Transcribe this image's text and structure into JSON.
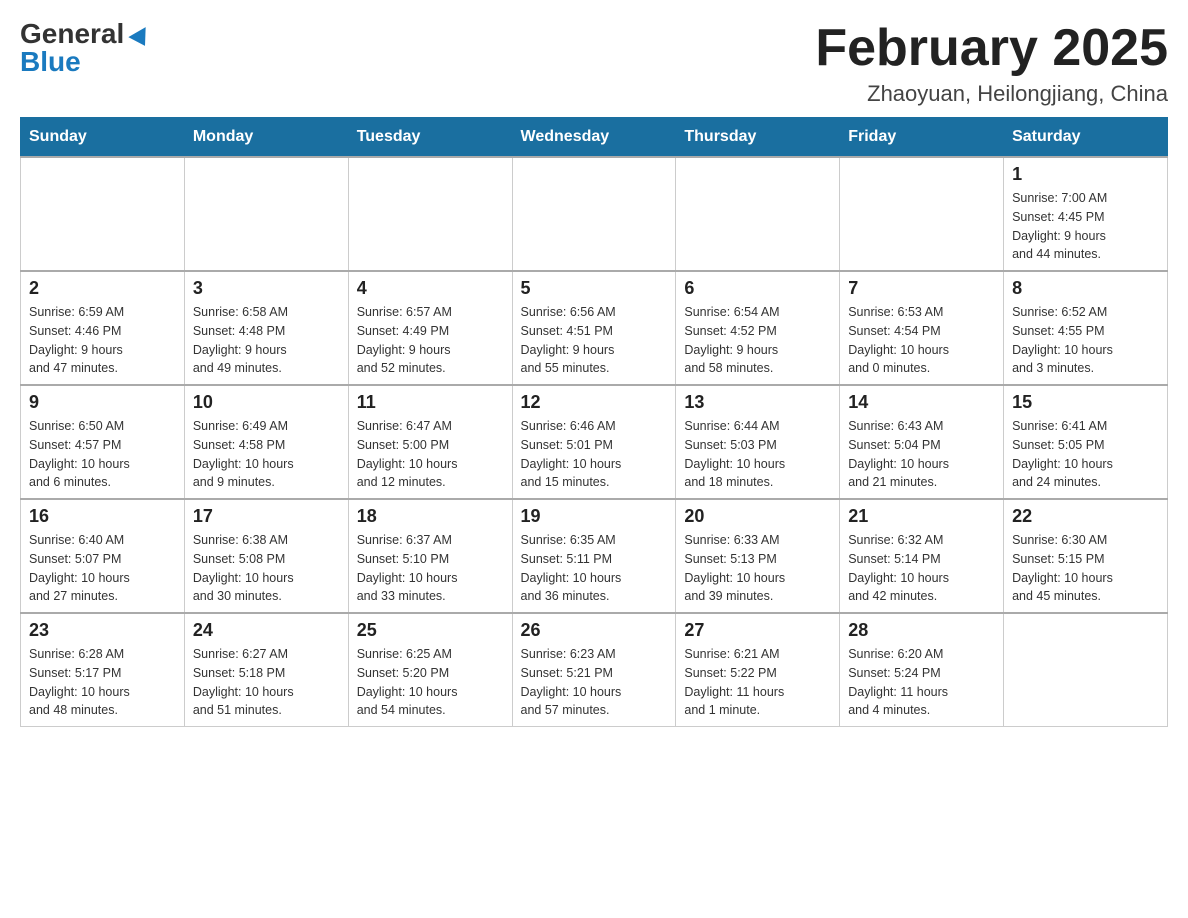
{
  "logo": {
    "general": "General",
    "blue": "Blue"
  },
  "title": "February 2025",
  "location": "Zhaoyuan, Heilongjiang, China",
  "days_of_week": [
    "Sunday",
    "Monday",
    "Tuesday",
    "Wednesday",
    "Thursday",
    "Friday",
    "Saturday"
  ],
  "weeks": [
    [
      {
        "day": "",
        "info": ""
      },
      {
        "day": "",
        "info": ""
      },
      {
        "day": "",
        "info": ""
      },
      {
        "day": "",
        "info": ""
      },
      {
        "day": "",
        "info": ""
      },
      {
        "day": "",
        "info": ""
      },
      {
        "day": "1",
        "info": "Sunrise: 7:00 AM\nSunset: 4:45 PM\nDaylight: 9 hours\nand 44 minutes."
      }
    ],
    [
      {
        "day": "2",
        "info": "Sunrise: 6:59 AM\nSunset: 4:46 PM\nDaylight: 9 hours\nand 47 minutes."
      },
      {
        "day": "3",
        "info": "Sunrise: 6:58 AM\nSunset: 4:48 PM\nDaylight: 9 hours\nand 49 minutes."
      },
      {
        "day": "4",
        "info": "Sunrise: 6:57 AM\nSunset: 4:49 PM\nDaylight: 9 hours\nand 52 minutes."
      },
      {
        "day": "5",
        "info": "Sunrise: 6:56 AM\nSunset: 4:51 PM\nDaylight: 9 hours\nand 55 minutes."
      },
      {
        "day": "6",
        "info": "Sunrise: 6:54 AM\nSunset: 4:52 PM\nDaylight: 9 hours\nand 58 minutes."
      },
      {
        "day": "7",
        "info": "Sunrise: 6:53 AM\nSunset: 4:54 PM\nDaylight: 10 hours\nand 0 minutes."
      },
      {
        "day": "8",
        "info": "Sunrise: 6:52 AM\nSunset: 4:55 PM\nDaylight: 10 hours\nand 3 minutes."
      }
    ],
    [
      {
        "day": "9",
        "info": "Sunrise: 6:50 AM\nSunset: 4:57 PM\nDaylight: 10 hours\nand 6 minutes."
      },
      {
        "day": "10",
        "info": "Sunrise: 6:49 AM\nSunset: 4:58 PM\nDaylight: 10 hours\nand 9 minutes."
      },
      {
        "day": "11",
        "info": "Sunrise: 6:47 AM\nSunset: 5:00 PM\nDaylight: 10 hours\nand 12 minutes."
      },
      {
        "day": "12",
        "info": "Sunrise: 6:46 AM\nSunset: 5:01 PM\nDaylight: 10 hours\nand 15 minutes."
      },
      {
        "day": "13",
        "info": "Sunrise: 6:44 AM\nSunset: 5:03 PM\nDaylight: 10 hours\nand 18 minutes."
      },
      {
        "day": "14",
        "info": "Sunrise: 6:43 AM\nSunset: 5:04 PM\nDaylight: 10 hours\nand 21 minutes."
      },
      {
        "day": "15",
        "info": "Sunrise: 6:41 AM\nSunset: 5:05 PM\nDaylight: 10 hours\nand 24 minutes."
      }
    ],
    [
      {
        "day": "16",
        "info": "Sunrise: 6:40 AM\nSunset: 5:07 PM\nDaylight: 10 hours\nand 27 minutes."
      },
      {
        "day": "17",
        "info": "Sunrise: 6:38 AM\nSunset: 5:08 PM\nDaylight: 10 hours\nand 30 minutes."
      },
      {
        "day": "18",
        "info": "Sunrise: 6:37 AM\nSunset: 5:10 PM\nDaylight: 10 hours\nand 33 minutes."
      },
      {
        "day": "19",
        "info": "Sunrise: 6:35 AM\nSunset: 5:11 PM\nDaylight: 10 hours\nand 36 minutes."
      },
      {
        "day": "20",
        "info": "Sunrise: 6:33 AM\nSunset: 5:13 PM\nDaylight: 10 hours\nand 39 minutes."
      },
      {
        "day": "21",
        "info": "Sunrise: 6:32 AM\nSunset: 5:14 PM\nDaylight: 10 hours\nand 42 minutes."
      },
      {
        "day": "22",
        "info": "Sunrise: 6:30 AM\nSunset: 5:15 PM\nDaylight: 10 hours\nand 45 minutes."
      }
    ],
    [
      {
        "day": "23",
        "info": "Sunrise: 6:28 AM\nSunset: 5:17 PM\nDaylight: 10 hours\nand 48 minutes."
      },
      {
        "day": "24",
        "info": "Sunrise: 6:27 AM\nSunset: 5:18 PM\nDaylight: 10 hours\nand 51 minutes."
      },
      {
        "day": "25",
        "info": "Sunrise: 6:25 AM\nSunset: 5:20 PM\nDaylight: 10 hours\nand 54 minutes."
      },
      {
        "day": "26",
        "info": "Sunrise: 6:23 AM\nSunset: 5:21 PM\nDaylight: 10 hours\nand 57 minutes."
      },
      {
        "day": "27",
        "info": "Sunrise: 6:21 AM\nSunset: 5:22 PM\nDaylight: 11 hours\nand 1 minute."
      },
      {
        "day": "28",
        "info": "Sunrise: 6:20 AM\nSunset: 5:24 PM\nDaylight: 11 hours\nand 4 minutes."
      },
      {
        "day": "",
        "info": ""
      }
    ]
  ]
}
